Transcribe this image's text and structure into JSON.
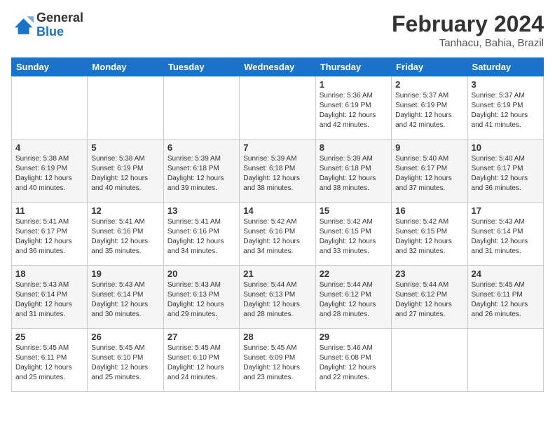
{
  "header": {
    "logo_general": "General",
    "logo_blue": "Blue",
    "month_title": "February 2024",
    "location": "Tanhacu, Bahia, Brazil"
  },
  "weekdays": [
    "Sunday",
    "Monday",
    "Tuesday",
    "Wednesday",
    "Thursday",
    "Friday",
    "Saturday"
  ],
  "weeks": [
    [
      null,
      null,
      null,
      null,
      {
        "day": "1",
        "sunrise": "5:36 AM",
        "sunset": "6:19 PM",
        "daylight": "12 hours and 42 minutes."
      },
      {
        "day": "2",
        "sunrise": "5:37 AM",
        "sunset": "6:19 PM",
        "daylight": "12 hours and 42 minutes."
      },
      {
        "day": "3",
        "sunrise": "5:37 AM",
        "sunset": "6:19 PM",
        "daylight": "12 hours and 41 minutes."
      }
    ],
    [
      {
        "day": "4",
        "sunrise": "5:38 AM",
        "sunset": "6:19 PM",
        "daylight": "12 hours and 40 minutes."
      },
      {
        "day": "5",
        "sunrise": "5:38 AM",
        "sunset": "6:19 PM",
        "daylight": "12 hours and 40 minutes."
      },
      {
        "day": "6",
        "sunrise": "5:39 AM",
        "sunset": "6:18 PM",
        "daylight": "12 hours and 39 minutes."
      },
      {
        "day": "7",
        "sunrise": "5:39 AM",
        "sunset": "6:18 PM",
        "daylight": "12 hours and 38 minutes."
      },
      {
        "day": "8",
        "sunrise": "5:39 AM",
        "sunset": "6:18 PM",
        "daylight": "12 hours and 38 minutes."
      },
      {
        "day": "9",
        "sunrise": "5:40 AM",
        "sunset": "6:17 PM",
        "daylight": "12 hours and 37 minutes."
      },
      {
        "day": "10",
        "sunrise": "5:40 AM",
        "sunset": "6:17 PM",
        "daylight": "12 hours and 36 minutes."
      }
    ],
    [
      {
        "day": "11",
        "sunrise": "5:41 AM",
        "sunset": "6:17 PM",
        "daylight": "12 hours and 36 minutes."
      },
      {
        "day": "12",
        "sunrise": "5:41 AM",
        "sunset": "6:16 PM",
        "daylight": "12 hours and 35 minutes."
      },
      {
        "day": "13",
        "sunrise": "5:41 AM",
        "sunset": "6:16 PM",
        "daylight": "12 hours and 34 minutes."
      },
      {
        "day": "14",
        "sunrise": "5:42 AM",
        "sunset": "6:16 PM",
        "daylight": "12 hours and 34 minutes."
      },
      {
        "day": "15",
        "sunrise": "5:42 AM",
        "sunset": "6:15 PM",
        "daylight": "12 hours and 33 minutes."
      },
      {
        "day": "16",
        "sunrise": "5:42 AM",
        "sunset": "6:15 PM",
        "daylight": "12 hours and 32 minutes."
      },
      {
        "day": "17",
        "sunrise": "5:43 AM",
        "sunset": "6:14 PM",
        "daylight": "12 hours and 31 minutes."
      }
    ],
    [
      {
        "day": "18",
        "sunrise": "5:43 AM",
        "sunset": "6:14 PM",
        "daylight": "12 hours and 31 minutes."
      },
      {
        "day": "19",
        "sunrise": "5:43 AM",
        "sunset": "6:14 PM",
        "daylight": "12 hours and 30 minutes."
      },
      {
        "day": "20",
        "sunrise": "5:43 AM",
        "sunset": "6:13 PM",
        "daylight": "12 hours and 29 minutes."
      },
      {
        "day": "21",
        "sunrise": "5:44 AM",
        "sunset": "6:13 PM",
        "daylight": "12 hours and 28 minutes."
      },
      {
        "day": "22",
        "sunrise": "5:44 AM",
        "sunset": "6:12 PM",
        "daylight": "12 hours and 28 minutes."
      },
      {
        "day": "23",
        "sunrise": "5:44 AM",
        "sunset": "6:12 PM",
        "daylight": "12 hours and 27 minutes."
      },
      {
        "day": "24",
        "sunrise": "5:45 AM",
        "sunset": "6:11 PM",
        "daylight": "12 hours and 26 minutes."
      }
    ],
    [
      {
        "day": "25",
        "sunrise": "5:45 AM",
        "sunset": "6:11 PM",
        "daylight": "12 hours and 25 minutes."
      },
      {
        "day": "26",
        "sunrise": "5:45 AM",
        "sunset": "6:10 PM",
        "daylight": "12 hours and 25 minutes."
      },
      {
        "day": "27",
        "sunrise": "5:45 AM",
        "sunset": "6:10 PM",
        "daylight": "12 hours and 24 minutes."
      },
      {
        "day": "28",
        "sunrise": "5:45 AM",
        "sunset": "6:09 PM",
        "daylight": "12 hours and 23 minutes."
      },
      {
        "day": "29",
        "sunrise": "5:46 AM",
        "sunset": "6:08 PM",
        "daylight": "12 hours and 22 minutes."
      },
      null,
      null
    ]
  ],
  "labels": {
    "sunrise": "Sunrise:",
    "sunset": "Sunset:",
    "daylight": "Daylight:"
  }
}
